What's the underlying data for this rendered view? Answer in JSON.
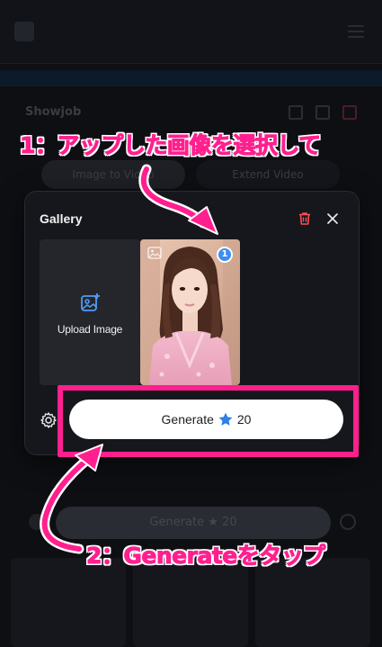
{
  "background_app": {
    "section_title": "Showjob",
    "tab_image": "Image to Video",
    "tab_video": "Extend Video",
    "generate_label": "Generate",
    "generate_cost": "20"
  },
  "gallery": {
    "title": "Gallery",
    "upload_label": "Upload Image",
    "selected_count": "1",
    "generate_label": "Generate",
    "generate_cost": "20",
    "icons": [
      "trash-icon",
      "close-icon",
      "image-add-icon",
      "image-icon",
      "settings-icon",
      "star-icon"
    ]
  },
  "annotations": {
    "step1": "1：アップした画像を選択して",
    "step2": "2：Generateをタップ"
  },
  "colors": {
    "accent_pink": "#ff1f8e",
    "trash_red": "#ff4d55",
    "badge_blue": "#3d8ef0",
    "star_blue": "#2f7fe8",
    "upload_icon_blue": "#4f9cf5"
  }
}
